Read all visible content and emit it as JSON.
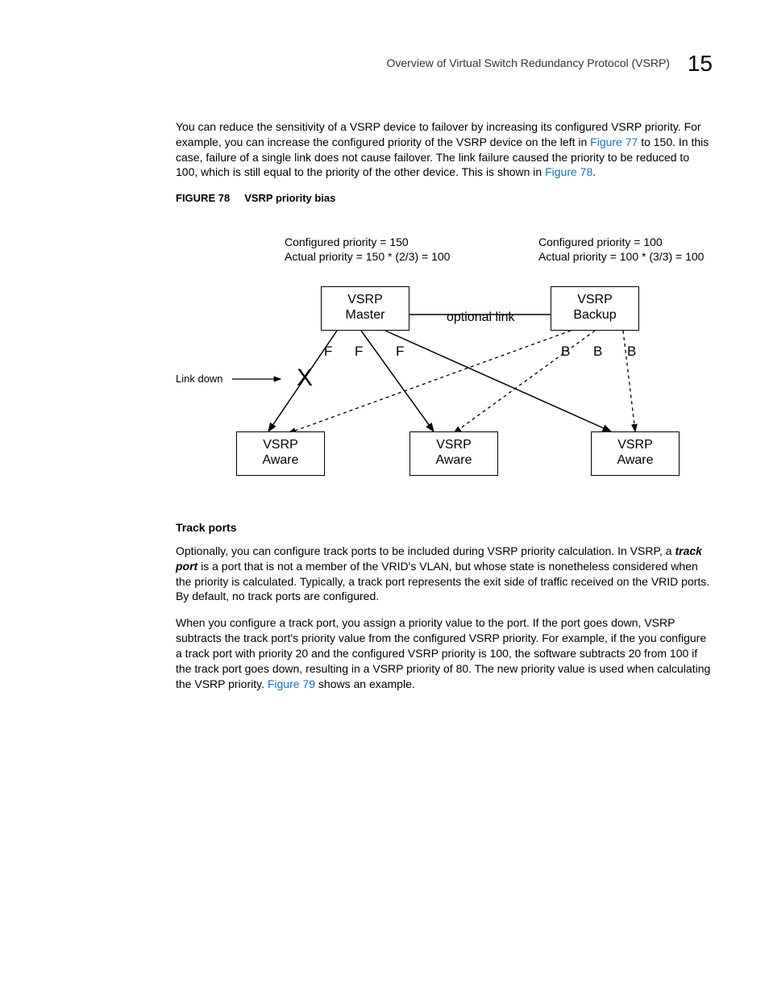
{
  "header": {
    "title": "Overview of Virtual Switch Redundancy Protocol (VSRP)",
    "chapter": "15"
  },
  "para1": {
    "t1": "You can reduce the sensitivity of a VSRP device to failover by increasing its configured VSRP priority. For example, you can increase the configured priority of the VSRP device on the left in ",
    "link1": "Figure 77",
    "t2": " to 150. In this case, failure of a single link does not cause failover. The link failure caused the priority to be reduced to 100, which is still equal to the priority of the other device. This is shown in ",
    "link2": "Figure 78",
    "t3": "."
  },
  "fig78": {
    "num": "FIGURE 78",
    "title": "VSRP priority bias"
  },
  "diagram": {
    "left_cfg": "Configured priority = 150",
    "left_act": "Actual priority = 150 * (2/3) = 100",
    "right_cfg": "Configured priority = 100",
    "right_act": "Actual priority = 100 * (3/3) = 100",
    "master_l1": "VSRP",
    "master_l2": "Master",
    "backup_l1": "VSRP",
    "backup_l2": "Backup",
    "optional": "optional link",
    "F": "F",
    "B": "B",
    "linkdown": "Link down",
    "X": "X",
    "aware_l1": "VSRP",
    "aware_l2": "Aware"
  },
  "trackports": {
    "heading": "Track ports",
    "p1a": "Optionally, you can configure track ports to be included during VSRP priority calculation.  In VSRP, a ",
    "p1b": "track port",
    "p1c": " is a port that is not a member of the VRID's VLAN, but whose state is nonetheless considered when the priority is calculated.  Typically, a track port represents the exit side of traffic received on the VRID ports.  By default, no track ports are configured.",
    "p2a": "When you configure a track port, you assign a priority value to the port. If the port goes down, VSRP subtracts the track port's priority value from the configured VSRP priority. For example, if the you configure a track port with priority 20 and the configured VSRP priority is 100, the software subtracts 20 from 100 if the track port goes down, resulting in a VSRP priority of 80. The new priority value is used when calculating the VSRP priority. ",
    "p2link": "Figure 79",
    "p2b": " shows an example."
  }
}
